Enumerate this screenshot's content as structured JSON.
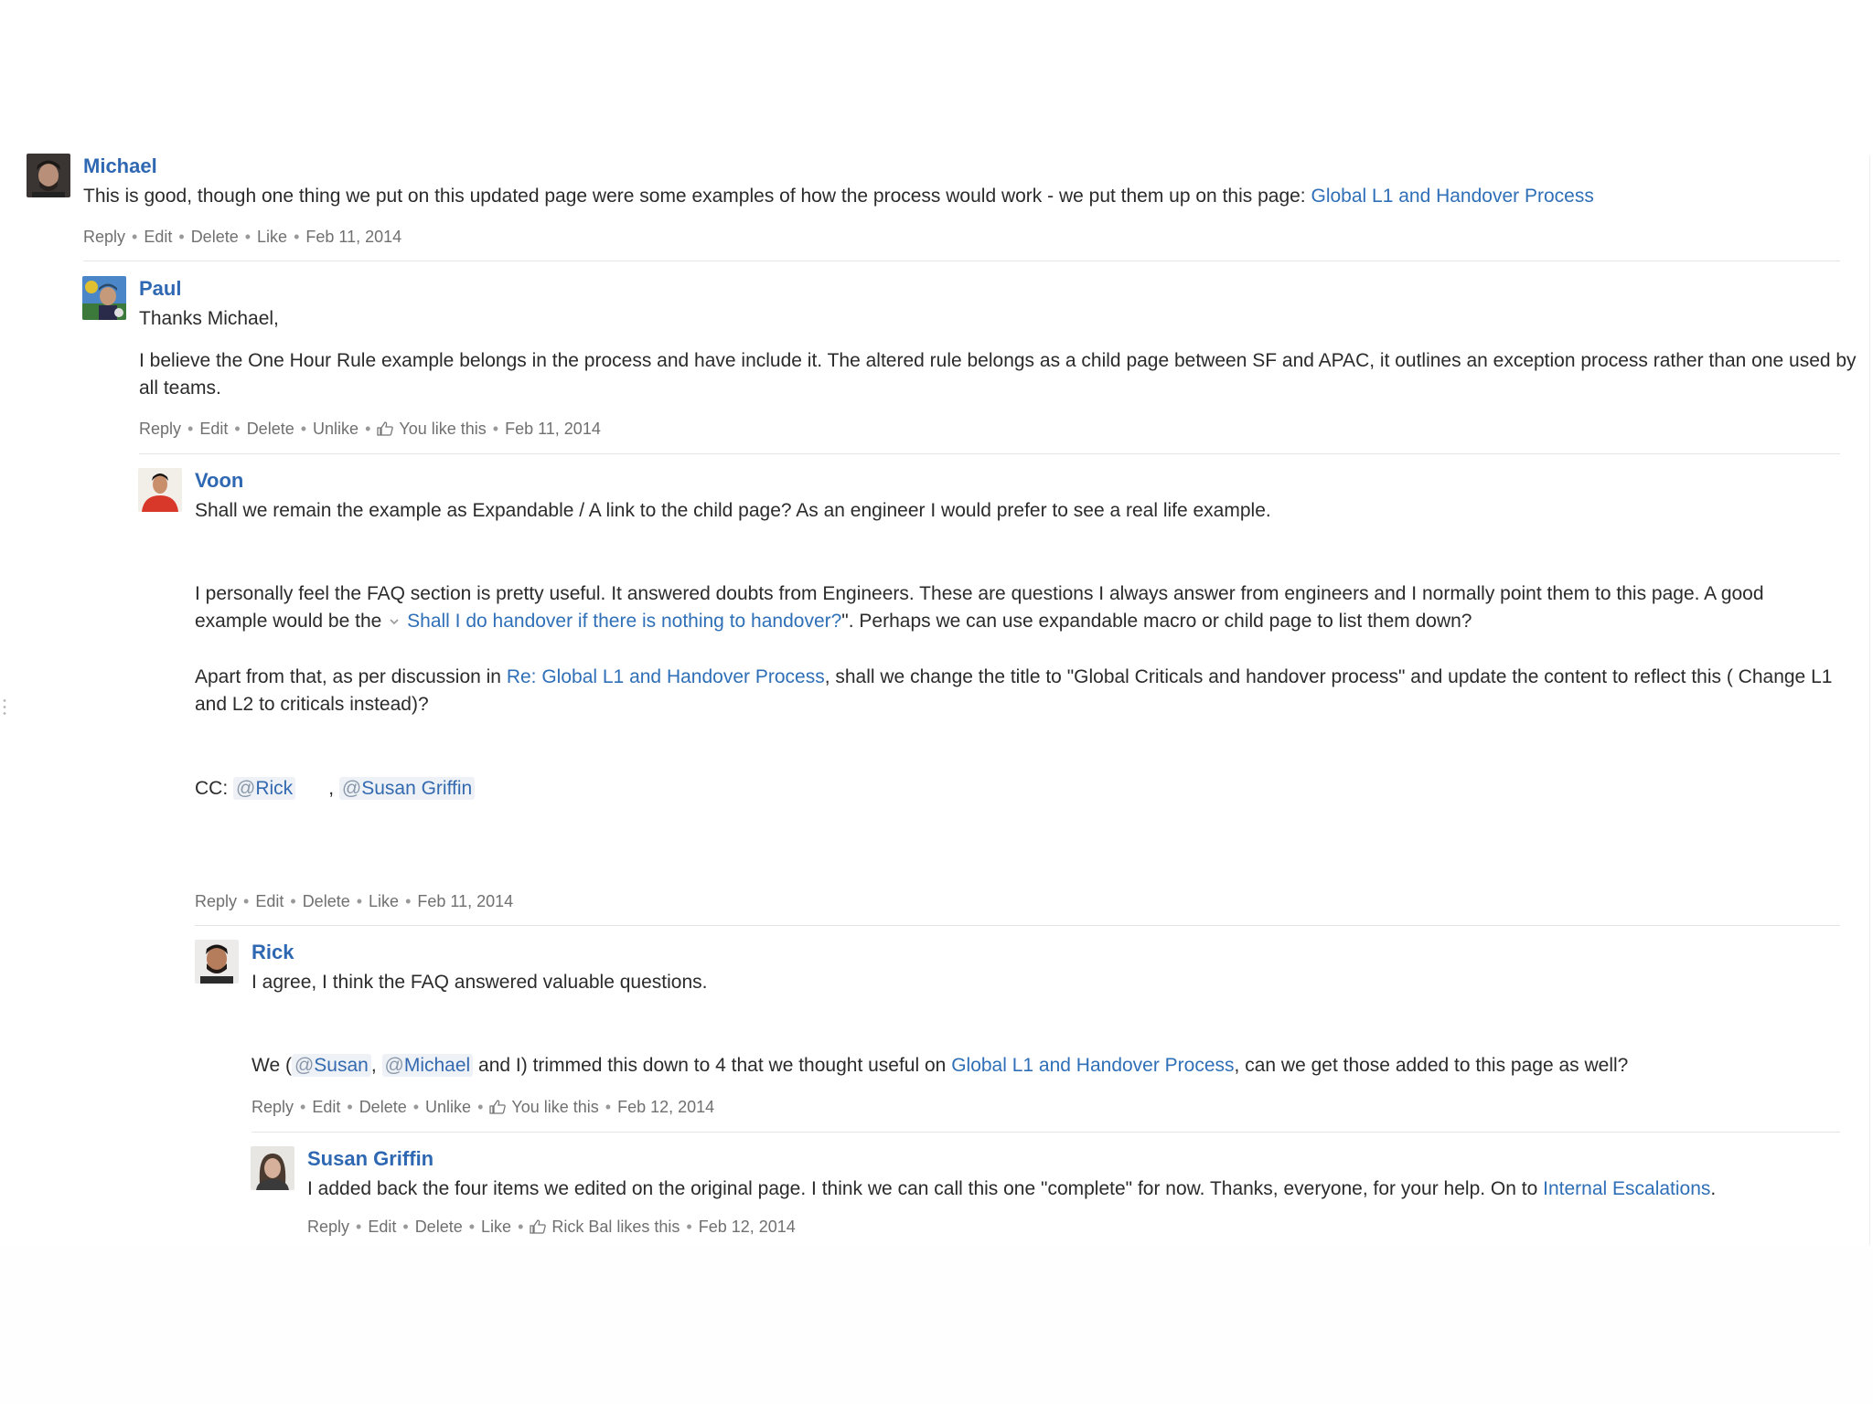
{
  "comments": {
    "michael": {
      "author": "Michael",
      "text_before": "This is good, though one thing we put on this updated page were some examples of how the process would work - we put them up on this page: ",
      "link": "Global L1 and Handover Process",
      "actions": [
        "Reply",
        "Edit",
        "Delete",
        "Like"
      ],
      "date": "Feb 11, 2014"
    },
    "paul": {
      "author": "Paul",
      "line1": "Thanks Michael,",
      "line2": "I believe the One Hour Rule example belongs in the process and have include it.  The altered rule belongs as a child page between SF and APAC, it outlines an exception process rather than one used by all teams.",
      "actions": [
        "Reply",
        "Edit",
        "Delete",
        "Unlike"
      ],
      "likes": "You like this",
      "date": "Feb 11, 2014"
    },
    "voon": {
      "author": "Voon",
      "p1": "Shall we remain the example as Expandable / A link to the child page? As an engineer I would prefer to see a real life example.",
      "p2_before": "I personally feel the FAQ section is pretty useful. It answered doubts from Engineers. These are questions I always answer from engineers and I normally point them to this page. A good example would be the ",
      "p2_link": "Shall I do handover if there is nothing to handover?",
      "p2_after": "\". Perhaps we can use expandable macro or child page to list them down?",
      "p3_before": "Apart from that, as per discussion in ",
      "p3_link": "Re: Global L1 and Handover Process",
      "p3_after": ", shall we change the title to \"Global Criticals and handover process\" and update the content to reflect this ( Change L1 and L2 to criticals instead)?",
      "cc_label": "CC:",
      "mention_1": "Rick",
      "mention_2": "Susan Griffin",
      "cc_separator": ",",
      "actions": [
        "Reply",
        "Edit",
        "Delete",
        "Like"
      ],
      "date": "Feb 11, 2014"
    },
    "rick": {
      "author": "Rick",
      "p1": "I agree, I think the FAQ answered valuable questions.",
      "p2_we": "We (",
      "mention_1": "Susan",
      "comma": ",",
      "mention_2": "Michael",
      "p2_mid": " and I) trimmed this down to 4 that we thought useful on ",
      "p2_link": "Global L1 and Handover Process",
      "p2_after": ", can we get those added to this page as well?",
      "actions": [
        "Reply",
        "Edit",
        "Delete",
        "Unlike"
      ],
      "likes": "You like this",
      "date": "Feb 12, 2014"
    },
    "susan": {
      "author": "Susan Griffin",
      "text_before": "I added back the four items we edited on the original page. I think we can call this one \"complete\" for now. Thanks, everyone, for your help. On to ",
      "link": "Internal Escalations",
      "text_after": ".",
      "actions": [
        "Reply",
        "Edit",
        "Delete",
        "Like"
      ],
      "likes": "Rick Bal likes this",
      "date": "Feb 12, 2014"
    }
  },
  "mention_prefix": "@",
  "separator_dot": "•",
  "icons": {
    "thumb": "thumbs-up-icon",
    "chevron": "chevron-down-icon"
  },
  "colors": {
    "author": "#2f68b2",
    "link": "#2f6fb7",
    "meta": "#707070",
    "text": "#2b2b2b"
  }
}
